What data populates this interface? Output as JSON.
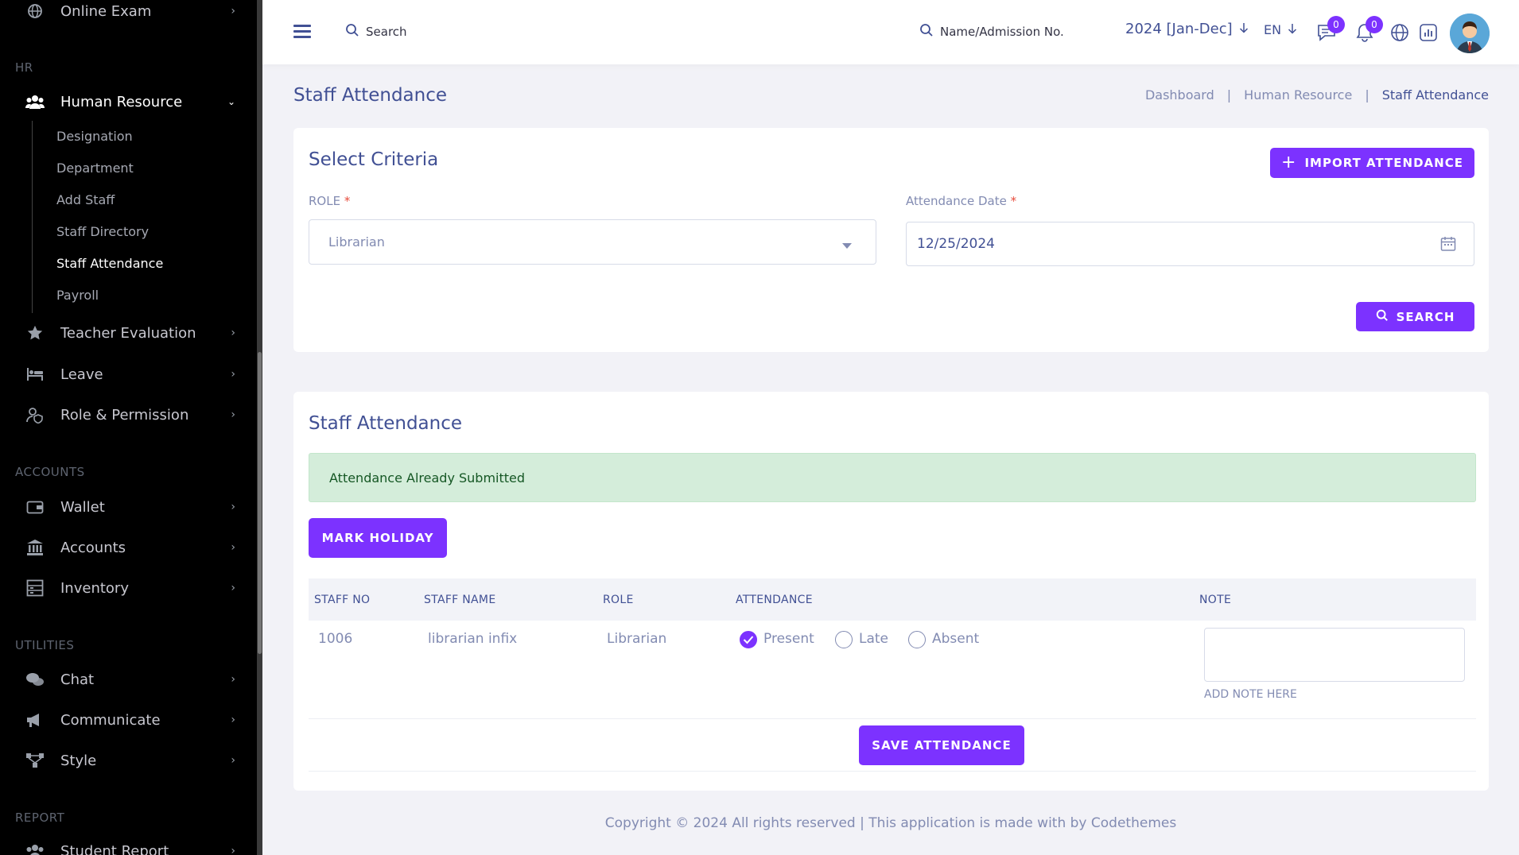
{
  "sidebar": {
    "top_item": {
      "label": "Online Exam"
    },
    "sections": {
      "hr": "HR",
      "accounts": "ACCOUNTS",
      "utilities": "UTILITIES",
      "report": "REPORT"
    },
    "human_resource": {
      "label": "Human Resource",
      "sub_items": [
        "Designation",
        "Department",
        "Add Staff",
        "Staff Directory",
        "Staff Attendance",
        "Payroll"
      ]
    },
    "items": {
      "teacher_evaluation": "Teacher Evaluation",
      "leave": "Leave",
      "role_permission": "Role & Permission",
      "wallet": "Wallet",
      "accounts": "Accounts",
      "inventory": "Inventory",
      "chat": "Chat",
      "communicate": "Communicate",
      "style": "Style",
      "student_report": "Student Report"
    }
  },
  "header": {
    "search_label": "Search",
    "search2_label": "Name/Admission No.",
    "session": "2024 [Jan-Dec]",
    "language": "EN",
    "chat_count": "0",
    "notification_count": "0"
  },
  "page": {
    "title": "Staff Attendance",
    "breadcrumb": [
      "Dashboard",
      "Human Resource",
      "Staff Attendance"
    ]
  },
  "criteria": {
    "title": "Select Criteria",
    "import_button": "IMPORT ATTENDANCE",
    "role_label": "ROLE",
    "role_value": "Librarian",
    "date_label": "Attendance Date",
    "date_value": "12/25/2024",
    "search_button": "SEARCH"
  },
  "attendance": {
    "title": "Staff Attendance",
    "alert": "Attendance Already Submitted",
    "mark_holiday": "MARK HOLIDAY",
    "columns": {
      "staff_no": "STAFF NO",
      "staff_name": "STAFF NAME",
      "role": "ROLE",
      "attendance": "ATTENDANCE",
      "note": "NOTE"
    },
    "row": {
      "staff_no": "1006",
      "staff_name": "librarian infix",
      "role": "Librarian",
      "options": [
        "Present",
        "Late",
        "Absent"
      ],
      "selected": "Present",
      "note_hint": "ADD NOTE HERE"
    },
    "save_button": "SAVE ATTENDANCE"
  },
  "footer": "Copyright © 2024 All rights reserved | This application is made with by Codethemes",
  "colors": {
    "accent": "#7c32ff",
    "text_primary": "#415094",
    "text_muted": "#828bb2",
    "sidebar_bg": "#000000",
    "alert_bg": "#d4edda"
  }
}
